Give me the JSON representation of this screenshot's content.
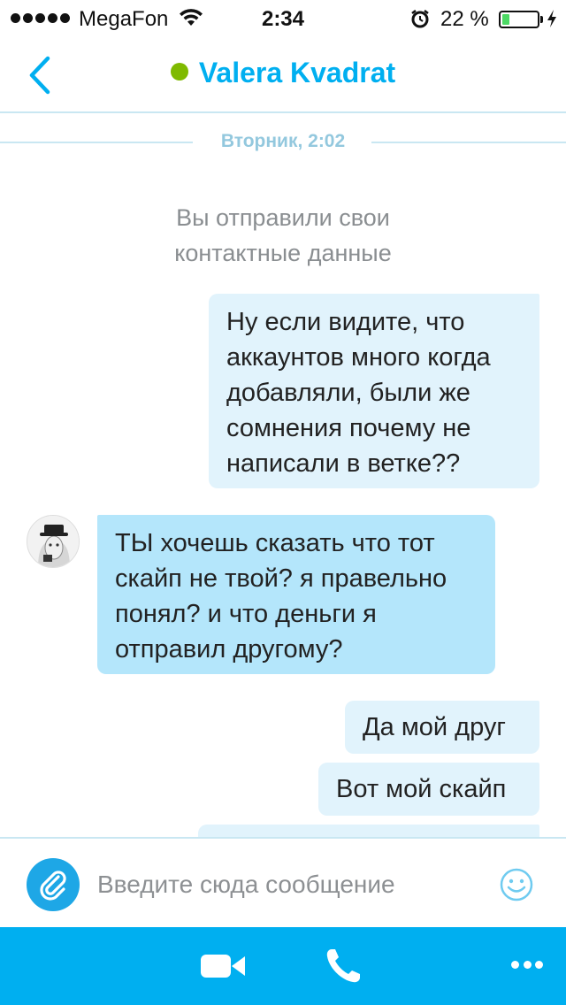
{
  "status_bar": {
    "carrier": "MegaFon",
    "time": "2:34",
    "battery_percent": "22 %",
    "battery_level": 0.22,
    "icons": [
      "signal-dots",
      "wifi-icon",
      "alarm-icon",
      "battery-icon",
      "charging-bolt-icon"
    ]
  },
  "header": {
    "contact_name": "Valera Kvadrat",
    "status": "online",
    "status_color": "#7fba00",
    "back_icon": "chevron-left-icon"
  },
  "conversation": {
    "date_separator": "Вторник, 2:02",
    "system_message": "Вы отправили свои контактные данные",
    "messages": [
      {
        "direction": "outgoing",
        "text": "Ну если видите, что аккаунтов много когда добавляли, были же сомнения почему не написали в ветке??"
      },
      {
        "direction": "incoming",
        "text": "ТЫ хочешь сказать что тот скайп не твой? я правельно понял? и что деньги я отправил другому?"
      },
      {
        "direction": "outgoing",
        "text": "Да мой друг"
      },
      {
        "direction": "outgoing",
        "text": "Вот мой скайп"
      },
      {
        "direction": "outgoing",
        "text": ""
      }
    ]
  },
  "composer": {
    "placeholder": "Введите сюда сообщение",
    "attach_icon": "paperclip-icon",
    "emoji_icon": "smiley-icon"
  },
  "toolbar": {
    "icons": [
      "video-camera-icon",
      "phone-icon",
      "more-icon"
    ]
  },
  "colors": {
    "accent": "#00aff0",
    "outgoing_bubble": "#e1f3fc",
    "incoming_bubble": "#b4e6fb",
    "divider": "#c9e7f2"
  }
}
